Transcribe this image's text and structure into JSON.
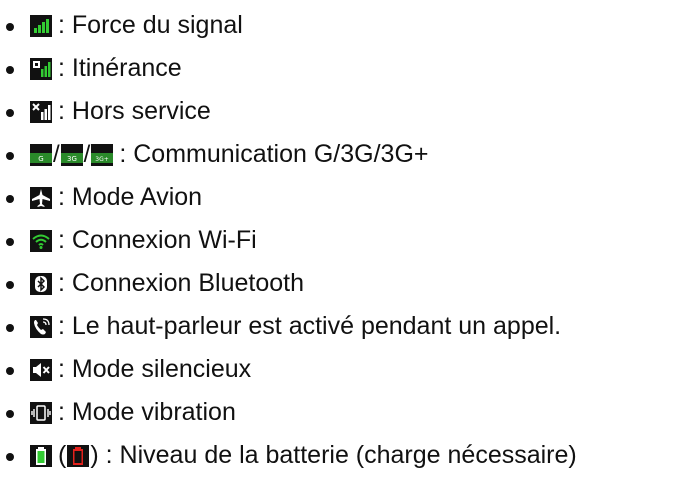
{
  "items": [
    {
      "label": ": Force du signal",
      "icon": "signal-strength-icon"
    },
    {
      "label": ": Itinérance",
      "icon": "roaming-icon"
    },
    {
      "label": ": Hors service",
      "icon": "no-service-icon"
    },
    {
      "label": ": Communication G/3G/3G+",
      "icon": "network-type-icons",
      "badges": [
        "G",
        "3G",
        "3G+"
      ]
    },
    {
      "label": ": Mode Avion",
      "icon": "airplane-icon"
    },
    {
      "label": ": Connexion Wi-Fi",
      "icon": "wifi-icon"
    },
    {
      "label": ": Connexion Bluetooth",
      "icon": "bluetooth-icon"
    },
    {
      "label": ": Le haut-parleur est activé pendant un appel.",
      "icon": "speakerphone-icon"
    },
    {
      "label": ": Mode silencieux",
      "icon": "silent-mode-icon"
    },
    {
      "label": ": Mode vibration",
      "icon": "vibration-icon"
    },
    {
      "label": ": Niveau de la batterie (charge nécessaire)",
      "icon": "battery-icon",
      "paren_open": "(",
      "paren_close": ")"
    }
  ],
  "colors": {
    "icon_bg": "#111111",
    "signal_green": "#33cc33",
    "battery_red": "#e3211c",
    "text": "#111111"
  }
}
